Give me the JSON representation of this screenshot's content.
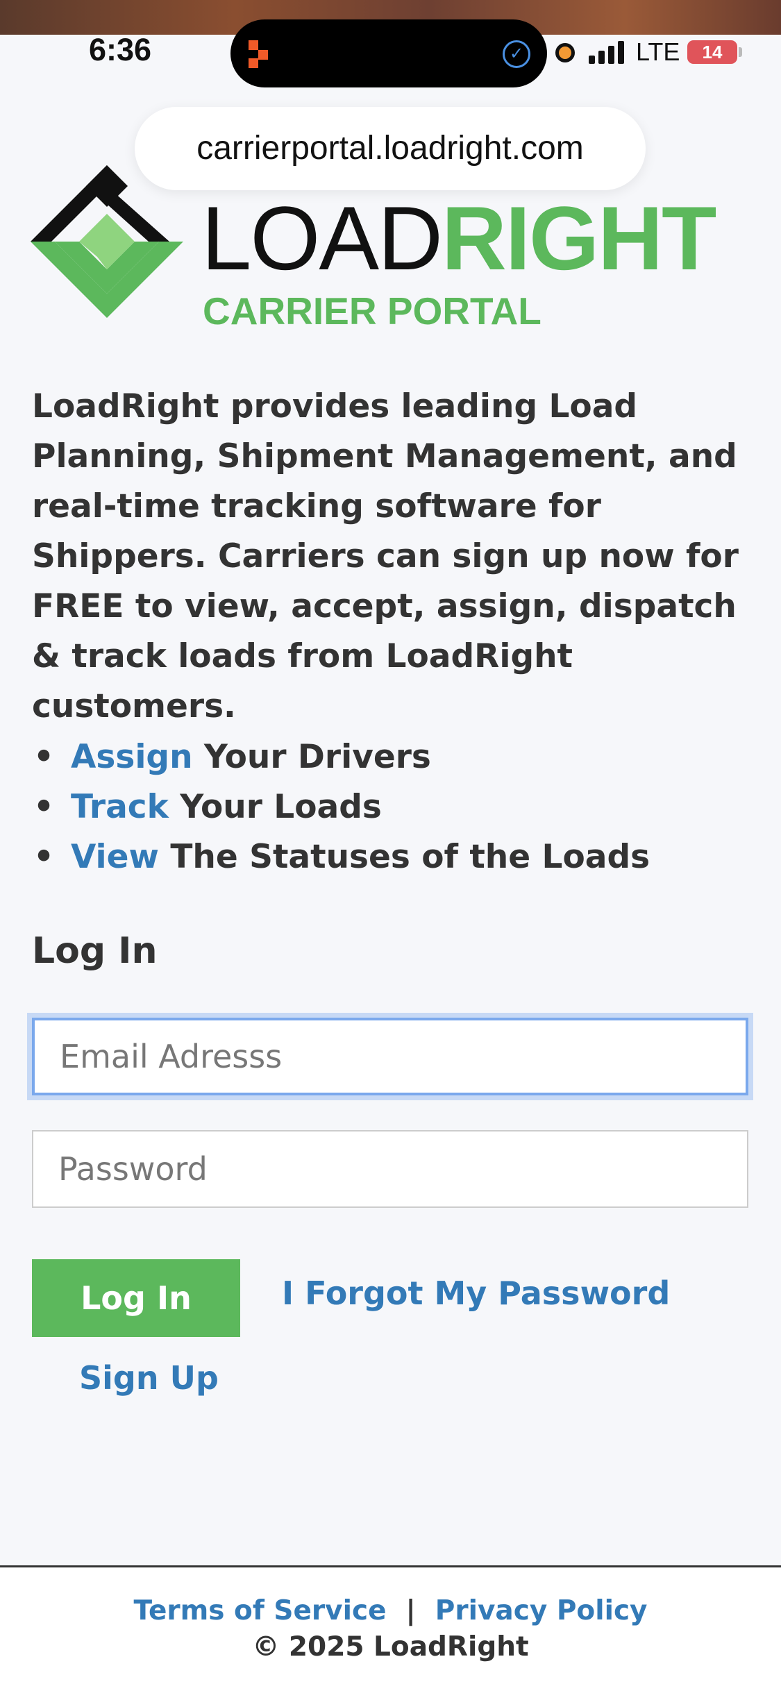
{
  "status_bar": {
    "time": "6:36",
    "carrier": "LTE",
    "battery": "14",
    "icons": [
      "app-icon",
      "check-circle-icon",
      "recording-dot-icon",
      "signal-icon",
      "battery-icon"
    ]
  },
  "browser": {
    "url": "carrierportal.loadright.com"
  },
  "logo": {
    "word_left": "LOAD",
    "word_right": "RIGHT",
    "subtitle": "CARRIER PORTAL",
    "colors": {
      "dark": "#111111",
      "green": "#5cb85c",
      "light_green": "#8fd47f"
    }
  },
  "intro": "LoadRight provides leading Load Planning, Shipment Management, and real-time tracking software for Shippers. Carriers can sign up now for FREE to view, accept, assign, dispatch & track loads from LoadRight customers.",
  "features": [
    {
      "link": "Assign",
      "text": " Your Drivers"
    },
    {
      "link": "Track",
      "text": " Your Loads"
    },
    {
      "link": "View",
      "text": " The Statuses of the Loads"
    }
  ],
  "login": {
    "heading": "Log In",
    "email_placeholder": "Email Adresss",
    "password_placeholder": "Password",
    "button": "Log In",
    "forgot": "I Forgot My Password",
    "signup": "Sign Up"
  },
  "footer": {
    "terms": "Terms of Service",
    "separator": "|",
    "privacy": "Privacy Policy",
    "copyright": "© 2025 LoadRight"
  },
  "colors": {
    "accent_link": "#337ab7",
    "button_green": "#5cb85c",
    "focus_ring": "#7aa8ec"
  }
}
